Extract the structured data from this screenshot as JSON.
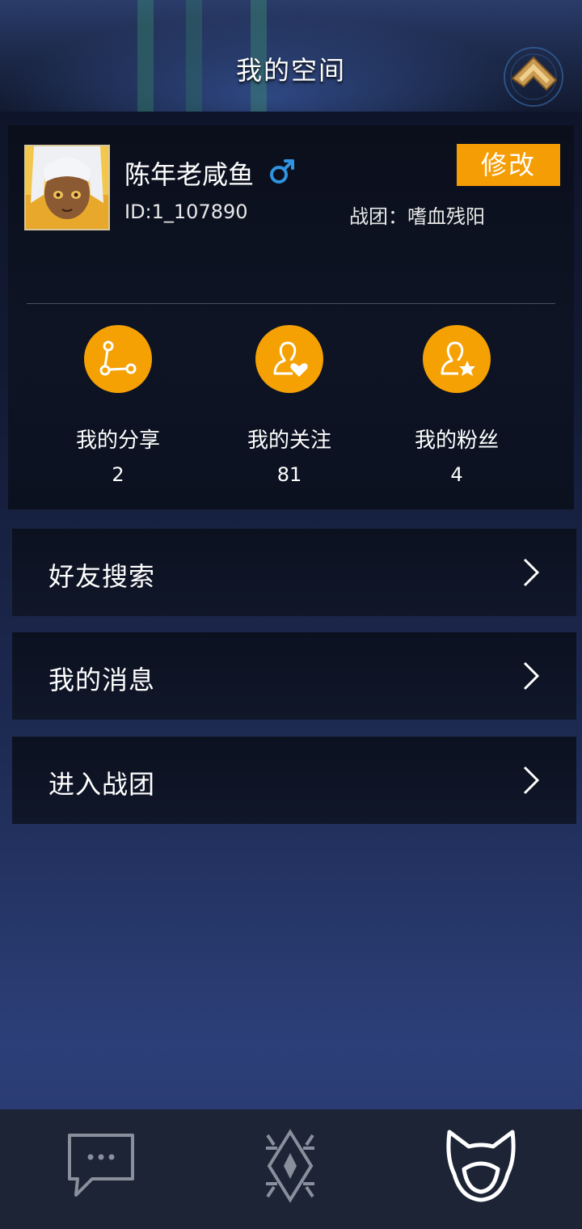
{
  "header": {
    "title": "我的空间",
    "home_icon": "home-icon"
  },
  "profile": {
    "username": "陈年老咸鱼",
    "gender_symbol": "♂",
    "user_id": "ID:1_107890",
    "guild": "战团：嗜血残阳",
    "edit_label": "修改"
  },
  "stats": [
    {
      "label": "我的分享",
      "count": "2",
      "icon": "share-icon"
    },
    {
      "label": "我的关注",
      "count": "81",
      "icon": "follow-heart-icon"
    },
    {
      "label": "我的粉丝",
      "count": "4",
      "icon": "fans-star-icon"
    }
  ],
  "menu": [
    {
      "label": "好友搜索"
    },
    {
      "label": "我的消息"
    },
    {
      "label": "进入战团"
    }
  ],
  "tabbar": {
    "tabs": [
      {
        "icon": "chat-icon",
        "active": false
      },
      {
        "icon": "game-crystal-icon",
        "active": false
      },
      {
        "icon": "cat-profile-icon",
        "active": true
      }
    ]
  },
  "colors": {
    "accent": "#f59d05",
    "gender_male": "#2f95e0",
    "card_bg": "#0b0f1c",
    "tabbar_bg": "#1c2436"
  }
}
